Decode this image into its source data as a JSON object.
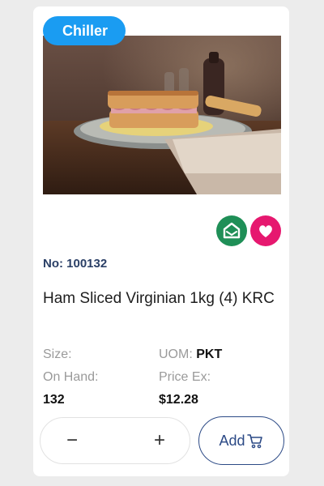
{
  "badge": {
    "label": "Chiller"
  },
  "product": {
    "number_label": "No: 100132",
    "name": "Ham Sliced Virginian 1kg (4) KRC",
    "image_alt": "ham sandwich photo"
  },
  "details": {
    "size_label": "Size:",
    "size_value": "",
    "uom_label": "UOM:",
    "uom_value": "PKT",
    "on_hand_label": "On Hand:",
    "on_hand_value": "132",
    "price_label": "Price Ex:",
    "price_value": "$12.28"
  },
  "quantity": {
    "minus": "−",
    "plus": "+"
  },
  "add_button": {
    "label": "Add"
  },
  "icons": {
    "location": "home-location-icon",
    "favorite": "heart-icon",
    "cart": "cart-icon"
  },
  "colors": {
    "badge": "#1a9cf2",
    "location": "#1f8f57",
    "favorite": "#e6186f",
    "accent": "#2c4a86"
  }
}
